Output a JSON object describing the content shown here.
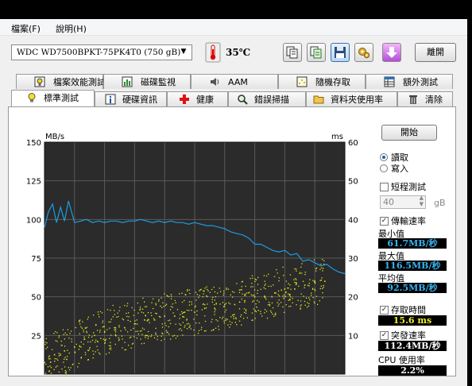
{
  "menu": {
    "file": "檔案(F)",
    "help": "說明(H)"
  },
  "toolbar": {
    "drive": "WDC WD7500BPKT-75PK4T0  (750 gB)",
    "temperature": "35℃",
    "exit": "離開"
  },
  "tabs_top": [
    "檔案效能測試",
    "磁碟監視",
    "AAM",
    "隨機存取",
    "額外測試"
  ],
  "tabs_bottom": [
    "標準測試",
    "硬碟資訊",
    "健康",
    "錯誤掃描",
    "資料夾使用率",
    "清除"
  ],
  "side": {
    "start": "開始",
    "read": "讀取",
    "write": "寫入",
    "short_test": "短程測試",
    "short_value": "40",
    "short_unit": "gB",
    "transfer_rate": "傳輸速率",
    "minimum": "最小值",
    "minimum_value": "61.7MB/秒",
    "maximum": "最大值",
    "maximum_value": "116.5MB/秒",
    "average": "平均值",
    "average_value": "92.5MB/秒",
    "access_time": "存取時間",
    "access_time_value": "15.6 ms",
    "burst_rate": "突發速率",
    "burst_rate_value": "112.4MB/秒",
    "cpu_usage": "CPU 使用率",
    "cpu_usage_value": "2.2%",
    "read_selected": true,
    "short_checked": false,
    "transfer_checked": true,
    "access_checked": true,
    "burst_checked": true
  },
  "colors": {
    "transfer_line": "#1e9be0",
    "access_points": "#e6e61e",
    "plot_bg": "#2b2b2b",
    "value_blue": "#38b4f0",
    "value_yellow": "#f0f028",
    "value_white": "#ffffff"
  },
  "chart_data": {
    "type": "line",
    "x_unit": "gB",
    "y_left_unit": "MB/s",
    "y_right_unit": "ms",
    "x_ticks": [
      "0",
      "75",
      "150",
      "225",
      "300",
      "375",
      "450",
      "525",
      "600",
      "675",
      "750gB"
    ],
    "y_left_ticks": [
      "150",
      "125",
      "100",
      "75",
      "50",
      "25"
    ],
    "y_right_ticks": [
      "60",
      "50",
      "40",
      "30",
      "20",
      "10"
    ],
    "xlim": [
      0,
      750
    ],
    "ylim_left": [
      0,
      150
    ],
    "ylim_right": [
      0,
      60
    ],
    "grid": true,
    "series": [
      {
        "axis": "left",
        "x": [
          0,
          10,
          20,
          30,
          40,
          50,
          60,
          75,
          90,
          105,
          120,
          135,
          150,
          165,
          180,
          195,
          210,
          225,
          240,
          255,
          270,
          285,
          300,
          315,
          330,
          345,
          360,
          375,
          390,
          405,
          420,
          435,
          450,
          465,
          480,
          495,
          510,
          525,
          540,
          555,
          570,
          585,
          600,
          615,
          630,
          645,
          660,
          675,
          690,
          705,
          720,
          735,
          750
        ],
        "y": [
          95,
          105,
          110,
          98,
          108,
          99,
          112,
          98,
          99,
          100,
          98,
          99,
          98,
          99,
          99,
          98,
          99,
          99,
          100,
          99,
          98,
          99,
          98,
          99,
          98,
          98,
          97,
          98,
          97,
          96,
          96,
          95,
          94,
          92,
          91,
          90,
          88,
          84,
          84,
          82,
          80,
          79,
          80,
          77,
          78,
          73,
          74,
          72,
          70,
          71,
          68,
          66,
          65
        ]
      },
      {
        "axis": "right",
        "type": "scatter",
        "x": [
          0,
          25,
          50,
          75,
          100,
          125,
          150,
          175,
          200,
          225,
          250,
          275,
          300,
          325,
          350,
          375,
          400,
          425,
          450,
          475,
          500,
          525,
          550,
          575,
          600,
          625,
          650,
          675,
          700
        ],
        "y": [
          3,
          5,
          6,
          7,
          9,
          10,
          11,
          12,
          12,
          13,
          14,
          14,
          15,
          15,
          16,
          16,
          17,
          17,
          18,
          18,
          19,
          20,
          20,
          21,
          22,
          22,
          23,
          24,
          24
        ]
      }
    ]
  }
}
